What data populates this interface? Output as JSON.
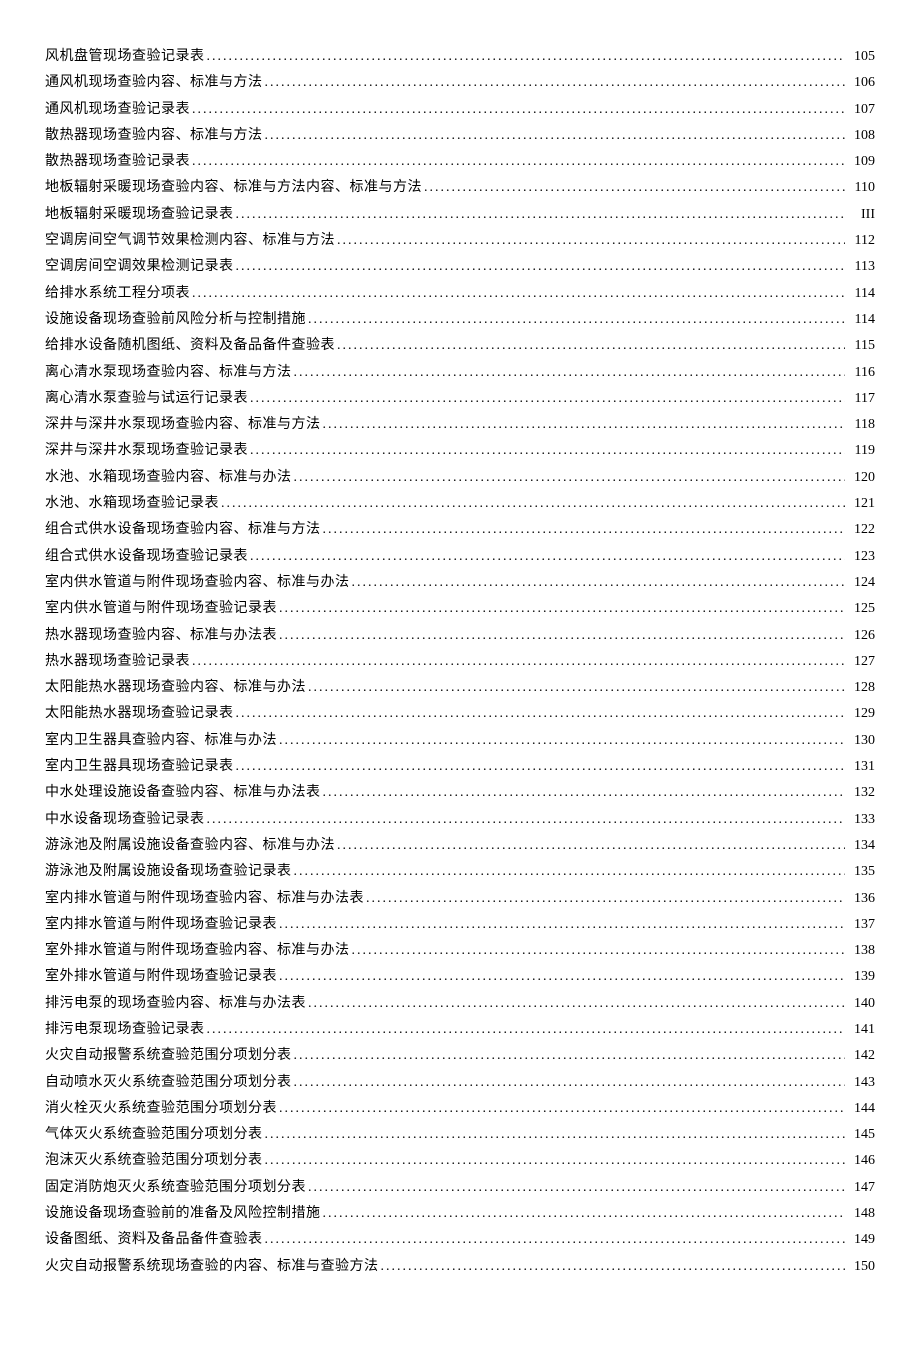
{
  "toc": [
    {
      "title": "风机盘管现场查验记录表",
      "page": "105"
    },
    {
      "title": "通风机现场查验内容、标准与方法",
      "page": "106"
    },
    {
      "title": "通风机现场查验记录表",
      "page": "107"
    },
    {
      "title": "散热器现场查验内容、标准与方法",
      "page": "108"
    },
    {
      "title": "散热器现场查验记录表",
      "page": "109"
    },
    {
      "title": "地板辐射采暖现场查验内容、标准与方法内容、标准与方法",
      "page": "110"
    },
    {
      "title": "地板辐射采暖现场查验记录表",
      "page": "III"
    },
    {
      "title": "空调房间空气调节效果检测内容、标准与方法",
      "page": "112"
    },
    {
      "title": "空调房间空调效果检测记录表",
      "page": "113"
    },
    {
      "title": "给排水系统工程分项表",
      "page": "114"
    },
    {
      "title": "设施设备现场查验前风险分析与控制措施",
      "page": "114"
    },
    {
      "title": "给排水设备随机图纸、资料及备品备件查验表",
      "page": "115"
    },
    {
      "title": "离心清水泵现场查验内容、标准与方法",
      "page": "116"
    },
    {
      "title": "离心清水泵查验与试运行记录表",
      "page": "117"
    },
    {
      "title": "深井与深井水泵现场查验内容、标准与方法",
      "page": "118"
    },
    {
      "title": "深井与深井水泵现场查验记录表",
      "page": "119"
    },
    {
      "title": "水池、水箱现场查验内容、标准与办法",
      "page": "120"
    },
    {
      "title": "水池、水箱现场查验记录表",
      "page": "121"
    },
    {
      "title": "组合式供水设备现场查验内容、标准与方法",
      "page": "122"
    },
    {
      "title": "组合式供水设备现场查验记录表",
      "page": "123"
    },
    {
      "title": "室内供水管道与附件现场查验内容、标准与办法",
      "page": "124"
    },
    {
      "title": "室内供水管道与附件现场查验记录表",
      "page": "125"
    },
    {
      "title": "热水器现场查验内容、标准与办法表",
      "page": "126"
    },
    {
      "title": "热水器现场查验记录表",
      "page": "127"
    },
    {
      "title": "太阳能热水器现场查验内容、标准与办法",
      "page": "128"
    },
    {
      "title": "太阳能热水器现场查验记录表",
      "page": "129"
    },
    {
      "title": "室内卫生器具查验内容、标准与办法",
      "page": "130"
    },
    {
      "title": "室内卫生器具现场查验记录表",
      "page": "131"
    },
    {
      "title": "中水处理设施设备查验内容、标准与办法表",
      "page": "132"
    },
    {
      "title": "中水设备现场查验记录表",
      "page": "133"
    },
    {
      "title": "游泳池及附属设施设备查验内容、标准与办法",
      "page": "134"
    },
    {
      "title": "游泳池及附属设施设备现场查验记录表",
      "page": "135"
    },
    {
      "title": "室内排水管道与附件现场查验内容、标准与办法表",
      "page": "136"
    },
    {
      "title": "室内排水管道与附件现场查验记录表",
      "page": "137"
    },
    {
      "title": "室外排水管道与附件现场查验内容、标准与办法",
      "page": "138"
    },
    {
      "title": "室外排水管道与附件现场查验记录表",
      "page": "139"
    },
    {
      "title": "排污电泵的现场查验内容、标准与办法表",
      "page": "140"
    },
    {
      "title": "排污电泵现场查验记录表",
      "page": "141"
    },
    {
      "title": "火灾自动报警系统查验范围分项划分表",
      "page": "142"
    },
    {
      "title": "自动喷水灭火系统查验范围分项划分表",
      "page": "143"
    },
    {
      "title": "消火栓灭火系统查验范围分项划分表",
      "page": "144"
    },
    {
      "title": "气体灭火系统查验范围分项划分表",
      "page": "145"
    },
    {
      "title": "泡沫灭火系统查验范围分项划分表",
      "page": "146"
    },
    {
      "title": "固定消防炮灭火系统查验范围分项划分表",
      "page": "147"
    },
    {
      "title": "设施设备现场查验前的准备及风险控制措施",
      "page": "148"
    },
    {
      "title": "设备图纸、资料及备品备件查验表",
      "page": "149"
    },
    {
      "title": "火灾自动报警系统现场查验的内容、标准与查验方法",
      "page": "150"
    }
  ]
}
